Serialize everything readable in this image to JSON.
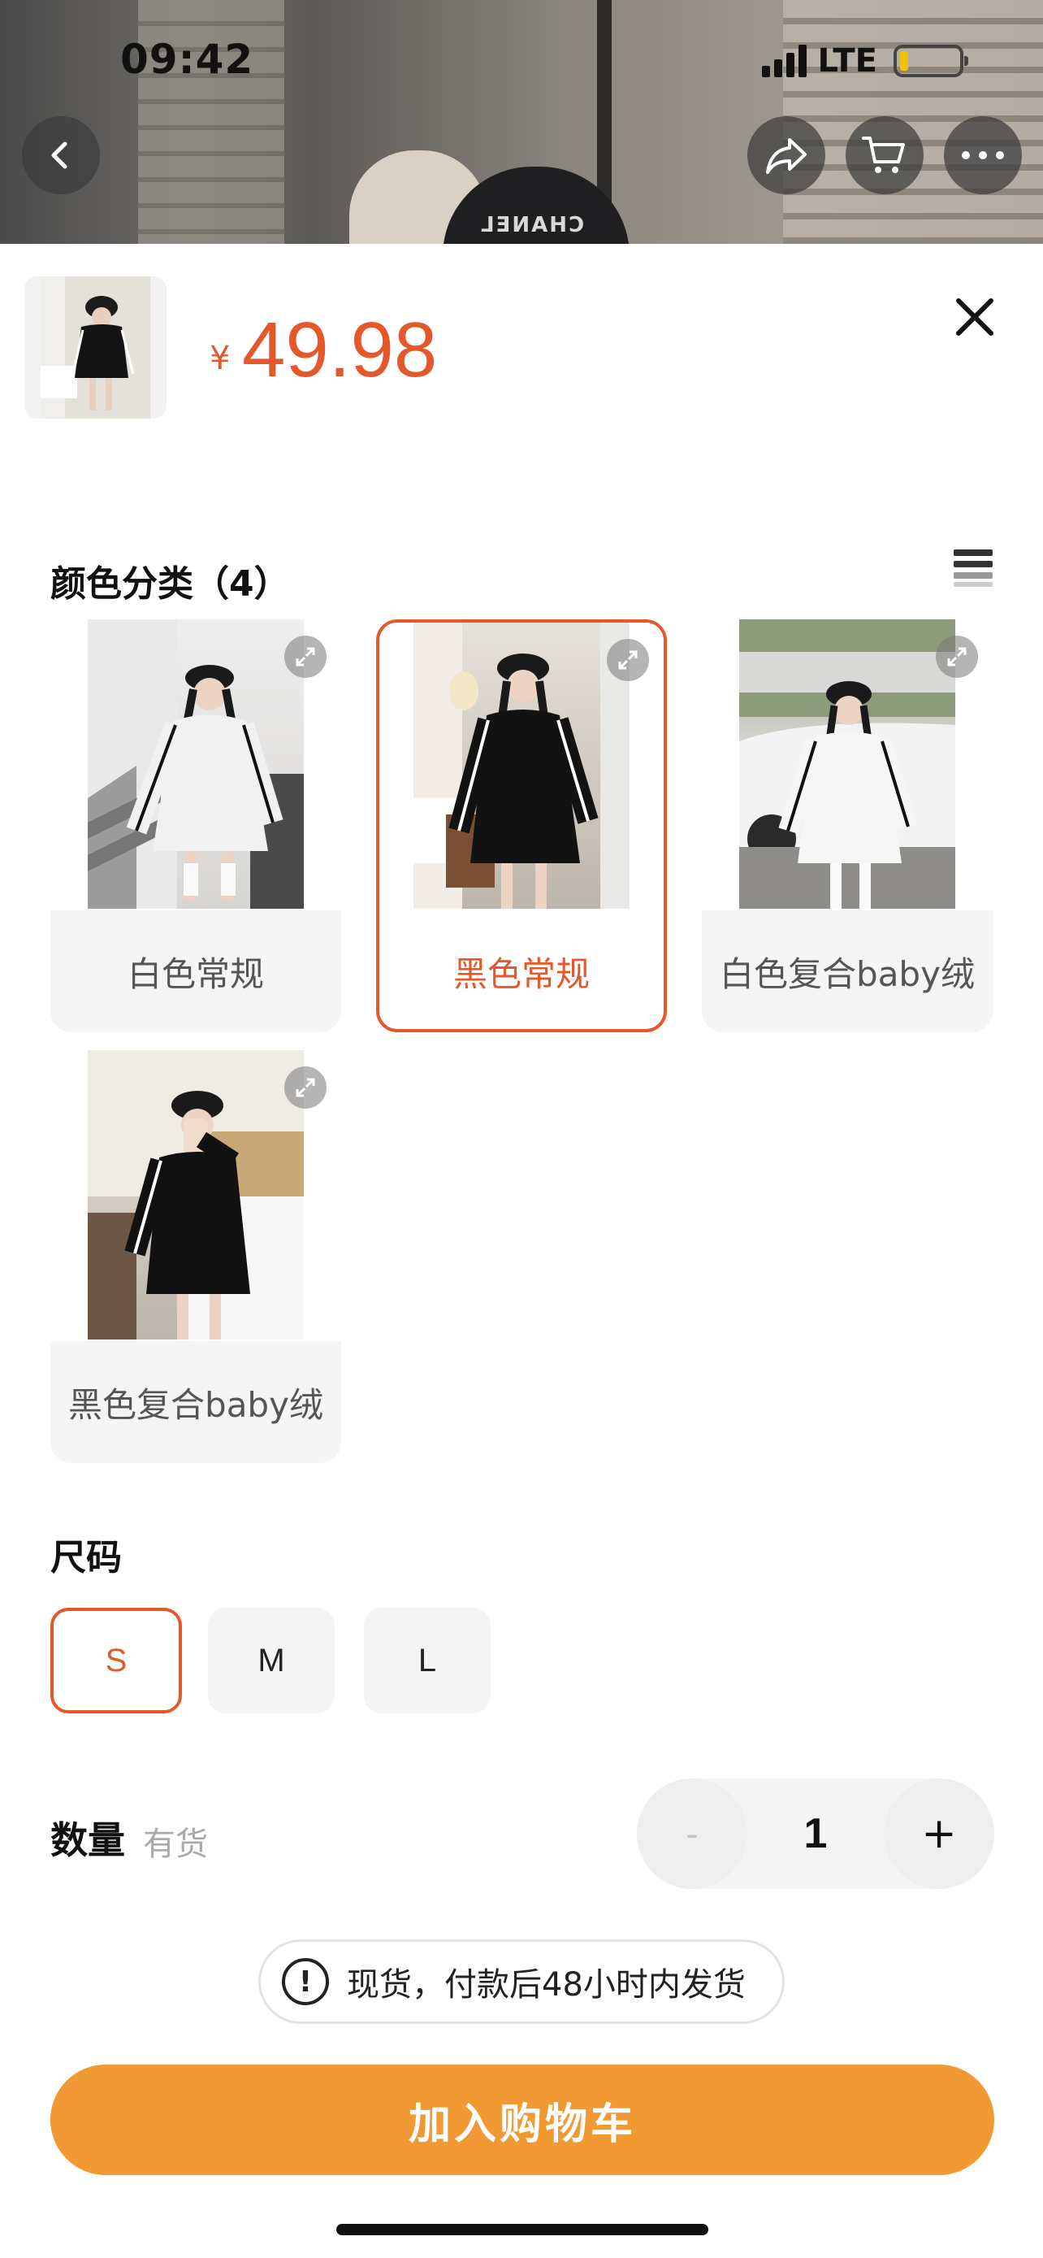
{
  "status_bar": {
    "time": "09:42",
    "network": "LTE"
  },
  "hero": {
    "hat_text": "CHANEL"
  },
  "product": {
    "currency": "¥",
    "price": "49.98"
  },
  "color_section": {
    "title": "颜色分类（4）",
    "options": [
      {
        "label": "白色常规",
        "selected": false
      },
      {
        "label": "黑色常规",
        "selected": true
      },
      {
        "label": "白色复合baby绒",
        "selected": false
      },
      {
        "label": "黑色复合baby绒",
        "selected": false
      }
    ]
  },
  "size_section": {
    "title": "尺码",
    "options": [
      {
        "label": "S",
        "selected": true
      },
      {
        "label": "M",
        "selected": false
      },
      {
        "label": "L",
        "selected": false
      }
    ]
  },
  "quantity": {
    "label": "数量",
    "stock": "有货",
    "minus": "-",
    "value": "1",
    "plus": "+"
  },
  "notice": {
    "icon": "!",
    "text": "现货，付款后48小时内发货"
  },
  "cta": {
    "label": "加入购物车"
  },
  "icons": {
    "back": "chevron-left-icon",
    "share": "share-arrow-icon",
    "cart": "cart-icon",
    "more": "more-dots-icon",
    "close": "close-icon",
    "list": "list-view-icon",
    "expand": "expand-icon"
  },
  "colors": {
    "accent": "#e4582a",
    "cta": "#f19a34",
    "chip_bg": "#f4f4f4"
  }
}
